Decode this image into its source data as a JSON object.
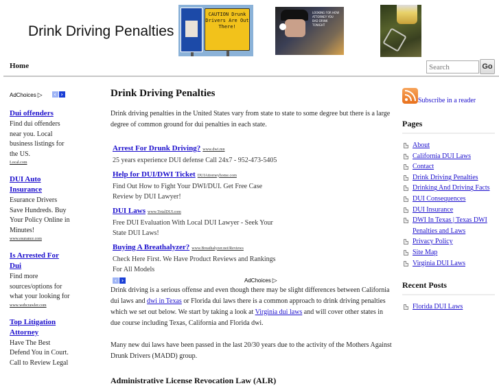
{
  "site": {
    "title": "Drink Driving Penalties",
    "caution_sign": "CAUTION Drunk Drivers Are Out There!",
    "police_caption": "LOOKING FOR HOW ATTORNEY YOU BAD DRINK TONIGHT",
    "images": [
      "caution-sign-image",
      "police-officer-image",
      "beer-and-keys-image"
    ]
  },
  "nav": {
    "home": "Home",
    "search_placeholder": "Search",
    "search_button": "Go"
  },
  "left_ads": {
    "adchoices": "AdChoices",
    "items": [
      {
        "title": "Dui offenders",
        "desc": "Find dui offenders near you. Local business listings for the US.",
        "url": "Local.com"
      },
      {
        "title": "DUI Auto Insurance",
        "desc": "Esurance Drivers Save Hundreds. Buy Your Policy Online in Minutes!",
        "url": "www.esurance.com"
      },
      {
        "title": "Is Arrested For Dui",
        "desc": "Find more sources/options for what your looking for",
        "url": "www.webcrawler.com"
      },
      {
        "title": "Top Litigation Attorney",
        "desc": "Have The Best Defend You in Court. Call to Review Legal",
        "url": ""
      }
    ]
  },
  "main": {
    "title": "Drink Driving Penalties",
    "intro": "Drink driving penalties in the United States vary from state to state to some degree but there is a large degree of common ground for dui penalties in each state.",
    "ads": [
      {
        "title": "Arrest For Drunk Driving?",
        "url": "www.dwi.mn",
        "desc": "25 years experience DUI defense Call 24x7 - 952-473-5405"
      },
      {
        "title": "Help for DUI/DWI Ticket",
        "url": "DUIAttorneyhome.com",
        "desc": "Find Out How to Fight Your DWI/DUI. Get Free Case Review by DUI Lawyer!"
      },
      {
        "title": "DUI Laws",
        "url": "www.TotalDUI.com",
        "desc": "Free DUI Evaluation With Local DUI Lawyer - Seek Your State DUI Laws!"
      },
      {
        "title": "Buying A Breathalyzer?",
        "url": "www.Breathalyzer.net/Reviews",
        "desc": "Check Here First. We Have Product Reviews and Rankings For All Models"
      }
    ],
    "adchoices": "AdChoices",
    "para1": {
      "a": "Drink driving is a serious offense and even though there may be slight differences between California dui laws and ",
      "link1": "dwi in Texas",
      "b": " or Florida dui laws there is a common approach to drink driving penalties which we set out below. We start by taking a look at ",
      "link2": "Virginia dui laws",
      "c": " and will cover other states in due course including Texas, California and Florida dwi."
    },
    "para2": "Many new dui laws have been passed in the last 20/30 years due to the activity of the Mothers Against Drunk Drivers (MADD) group.",
    "subheading": "Administrative License Revocation Law (ALR)"
  },
  "sidebar": {
    "subscribe": "Subscribe in a reader",
    "pages_title": "Pages",
    "pages": [
      "About",
      "California DUI Laws",
      "Contact",
      "Drink Driving Penalties",
      "Drinking And Driving Facts",
      "DUI Consequences",
      "DUI Insurance",
      "DWI In Texas | Texas DWI Penalties and Laws",
      "Privacy Policy",
      "Site Map",
      "Virginia DUI Laws"
    ],
    "recent_title": "Recent Posts",
    "recent": [
      "Florida DUI Laws"
    ]
  }
}
